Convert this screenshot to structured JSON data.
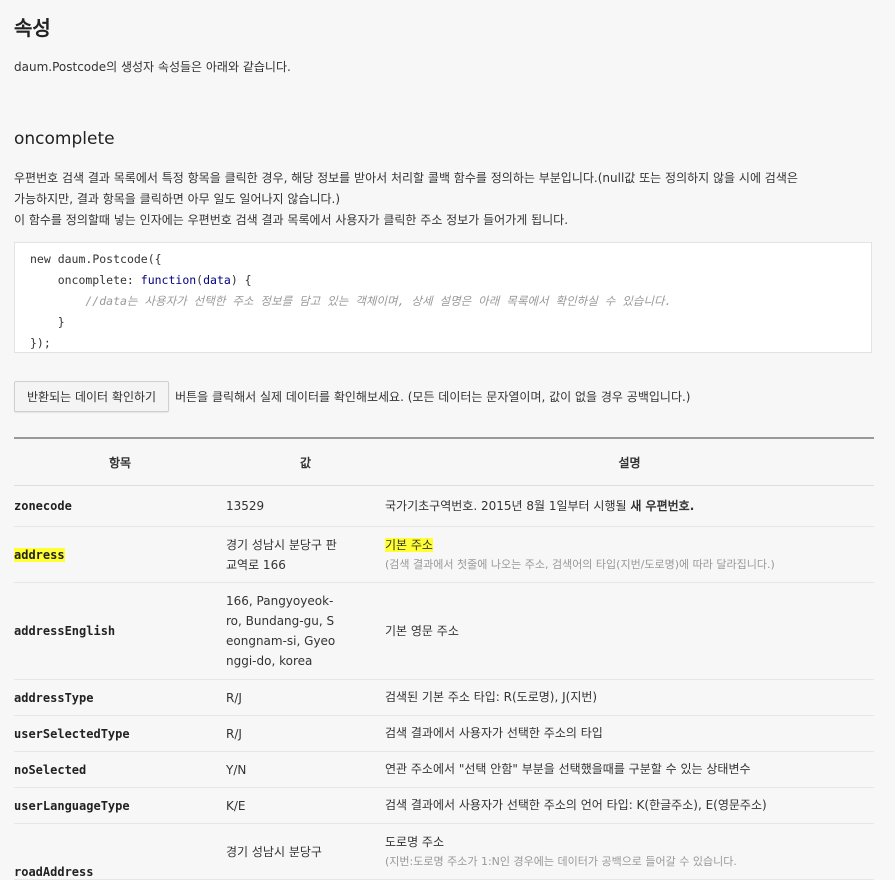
{
  "section_title": "속성",
  "intro": "daum.Postcode의 생성자 속성들은 아래와 같습니다.",
  "oncomplete": {
    "title": "oncomplete",
    "desc_line1": "우편번호 검색 결과 목록에서 특정 항목을 클릭한 경우, 해당 정보를 받아서 처리할 콜백 함수를 정의하는 부분입니다.(null값 또는 정의하지 않을 시에 검색은",
    "desc_line2": "가능하지만, 결과 항목을 클릭하면 아무 일도 일어나지 않습니다.)",
    "desc_line3": "이 함수를 정의할때 넣는 인자에는 우편번호 검색 결과 목록에서 사용자가 클릭한 주소 정보가 들어가게 됩니다.",
    "code": {
      "l1_kw": "new",
      "l1_rest": " daum.Postcode({",
      "l2_prop": "    oncomplete: ",
      "l2_fn": "function",
      "l2_open": "(",
      "l2_arg": "data",
      "l2_close": ") {",
      "l3_comment": "        //data는 사용자가 선택한 주소 정보를 담고 있는 객체이며, 상세 설명은 아래 목록에서 확인하실 수 있습니다.",
      "l4": "    }",
      "l5": "});"
    }
  },
  "check_button": "반환되는 데이터 확인하기",
  "check_note": "버튼을 클릭해서 실제 데이터를 확인해보세요. (모든 데이터는 문자열이며, 값이 없을 경우 공백입니다.)",
  "table": {
    "headers": [
      "항목",
      "값",
      "설명"
    ],
    "rows": [
      {
        "key": "zonecode",
        "value": "13529",
        "desc": "국가기초구역번호. 2015년 8월 1일부터 시행될 ",
        "desc_bold": "새 우편번호."
      },
      {
        "key": "address",
        "value": "경기 성남시 분당구 판교역로 166",
        "desc": "기본 주소",
        "desc_small": "(검색 결과에서 첫줄에 나오는 주소, 검색어의 타입(지번/도로명)에 따라 달라집니다.)"
      },
      {
        "key": "addressEnglish",
        "value": "166, Pangyoyeok-ro, Bundang-gu, Seongnam-si, Gyeonggi-do, korea",
        "desc": "기본 영문 주소"
      },
      {
        "key": "addressType",
        "value": "R/J",
        "desc": "검색된 기본 주소 타입: R(도로명), J(지번)"
      },
      {
        "key": "userSelectedType",
        "value": "R/J",
        "desc": "검색 결과에서 사용자가 선택한 주소의 타입"
      },
      {
        "key": "noSelected",
        "value": "Y/N",
        "desc": "연관 주소에서 \"선택 안함\" 부분을 선택했을때를 구분할 수 있는 상태변수"
      },
      {
        "key": "userLanguageType",
        "value": "K/E",
        "desc": "검색 결과에서 사용자가 선택한 주소의 언어 타입: K(한글주소), E(영문주소)"
      },
      {
        "key": "roadAddress",
        "value": "경기 성남시 분당구",
        "desc": "도로명 주소",
        "desc_small": "(지번:도로명 주소가 1:N인 경우에는 데이터가 공백으로 들어갈 수 있습니다."
      }
    ]
  },
  "colors": {
    "highlight": "#ffff33",
    "background": "#f7f7f7"
  }
}
